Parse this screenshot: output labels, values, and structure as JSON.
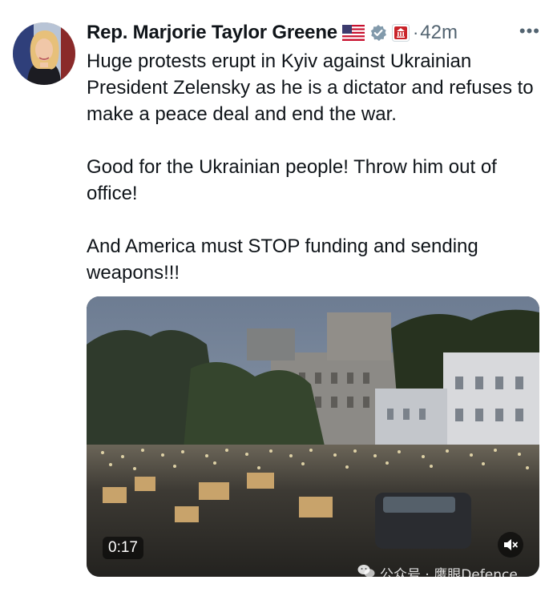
{
  "tweet": {
    "author_name": "Rep. Marjorie Taylor Greene",
    "flag_icon": "us-flag-icon",
    "verified_icon": "verified-badge-icon",
    "affiliation_icon": "government-affiliation-icon",
    "separator": "·",
    "timestamp": "42m",
    "more_label": "•••",
    "paragraphs": [
      "Huge protests erupt in Kyiv against Ukrainian President Zelensky as he is a dictator and refuses to make a peace deal and end the war.",
      "Good for the Ukrainian people! Throw him out of office!",
      "And America must STOP funding and sending weapons!!!"
    ]
  },
  "video": {
    "duration": "0:17",
    "mute_icon": "volume-muted-icon"
  },
  "watermark": {
    "icon": "wechat-icon",
    "text": "公众号 · 鹰眼Defence"
  }
}
